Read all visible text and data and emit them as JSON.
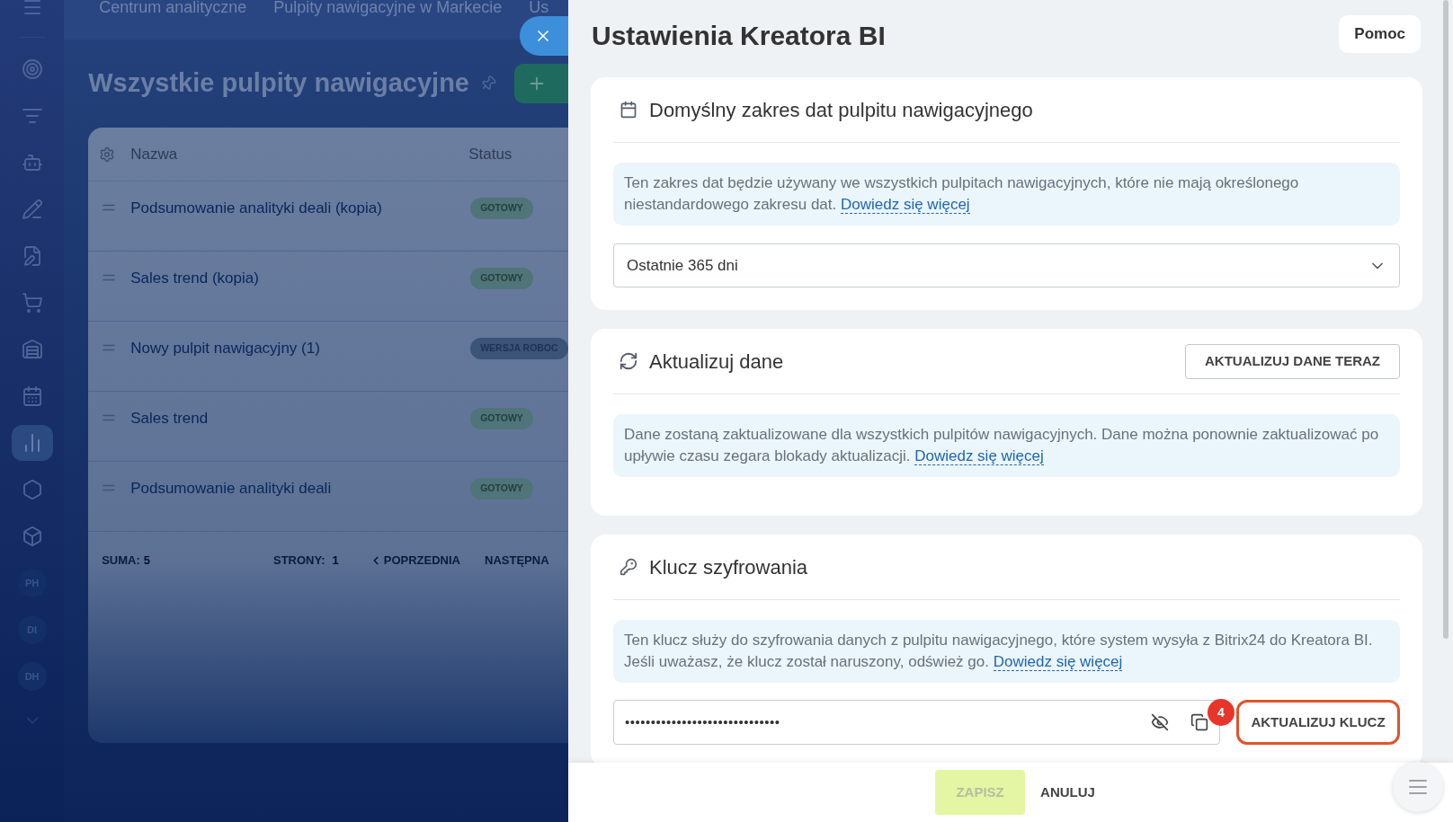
{
  "top_tabs": [
    {
      "label": "Centrum analityczne"
    },
    {
      "label": "Pulpity nawigacyjne w Markecie"
    },
    {
      "label": "Us"
    }
  ],
  "sidebar": {
    "items": [
      {
        "selected": false
      },
      {
        "selected": false
      },
      {
        "selected": false
      },
      {
        "selected": false
      },
      {
        "selected": false
      },
      {
        "selected": false
      },
      {
        "selected": false
      },
      {
        "selected": false
      },
      {
        "selected": true
      },
      {
        "selected": false
      },
      {
        "selected": false
      },
      {
        "label": "PH",
        "selected": false
      },
      {
        "label": "DI",
        "selected": false
      },
      {
        "label": "DH",
        "selected": false
      }
    ]
  },
  "page_title": "Wszystkie pulpity nawigacyjne",
  "table": {
    "columns": [
      "Nazwa",
      "Status"
    ],
    "rows": [
      {
        "name": "Podsumowanie analityki deali (kopia)",
        "status": "GOTOWY",
        "kind": "ready"
      },
      {
        "name": "Sales trend (kopia)",
        "status": "GOTOWY",
        "kind": "ready"
      },
      {
        "name": "Nowy pulpit nawigacyjny (1)",
        "status": "WERSJA ROBOC",
        "kind": "draft"
      },
      {
        "name": "Sales trend",
        "status": "GOTOWY",
        "kind": "ready"
      },
      {
        "name": "Podsumowanie analityki deali",
        "status": "GOTOWY",
        "kind": "ready"
      }
    ],
    "footer": {
      "total_label": "SUMA:",
      "total": "5",
      "pages_label": "STRONY:",
      "pages": "1",
      "prev": "POPRZEDNIA",
      "next": "NASTĘPNA"
    }
  },
  "panel": {
    "title": "Ustawienia Kreatora BI",
    "help_button": "Pomoc",
    "sections": [
      {
        "kind": "date_range",
        "title": "Domyślny zakres dat pulpitu nawigacyjnego",
        "info": "Ten zakres dat będzie używany we wszystkich pulpitach nawigacyjnych, które nie mają określonego niestandardowego zakresu dat.",
        "link": "Dowiedz się więcej",
        "select_value": "Ostatnie 365 dni"
      },
      {
        "kind": "refresh",
        "title": "Aktualizuj dane",
        "action": "AKTUALIZUJ DANE TERAZ",
        "info": "Dane zostaną zaktualizowane dla wszystkich pulpitów nawigacyjnych. Dane można ponownie zaktualizować po upływie czasu zegara blokady aktualizacji.",
        "link": "Dowiedz się więcej"
      },
      {
        "kind": "key",
        "title": "Klucz szyfrowania",
        "info": "Ten klucz służy do szyfrowania danych z pulpitu nawigacyjnego, które system wysyła z Bitrix24 do Kreatora BI. Jeśli uważasz, że klucz został naruszony, odśwież go.",
        "link": "Dowiedz się więcej",
        "key_value": "••••••••••••••••••••••••••••••",
        "action": "AKTUALIZUJ KLUCZ",
        "highlighted": true,
        "annotation": "4"
      }
    ],
    "footer": {
      "save": "ZAPISZ",
      "save_disabled": true,
      "cancel": "ANULUJ"
    }
  }
}
